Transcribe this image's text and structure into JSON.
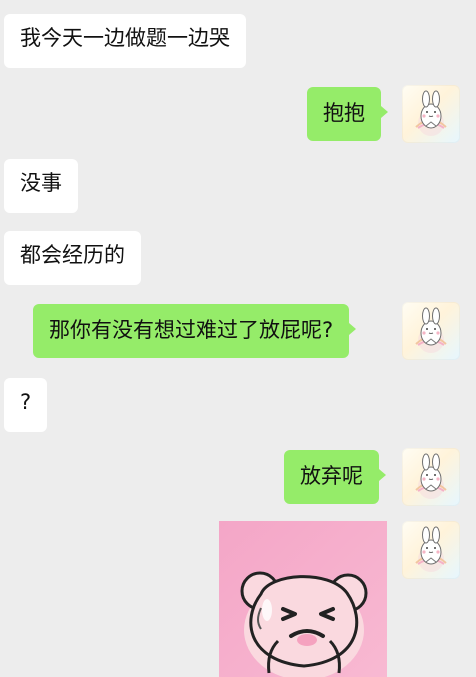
{
  "chat": {
    "messages": [
      {
        "side": "incoming",
        "text": "我今天一边做题一边哭"
      },
      {
        "side": "outgoing",
        "text": "抱抱"
      },
      {
        "side": "incoming",
        "text": "没事"
      },
      {
        "side": "incoming",
        "text": "都会经历的"
      },
      {
        "side": "outgoing",
        "text": "那你有没有想过难过了放屁呢?"
      },
      {
        "side": "incoming",
        "text": "?"
      },
      {
        "side": "outgoing",
        "text": "放弃呢"
      },
      {
        "side": "outgoing",
        "type": "sticker",
        "description_icon": "pink-bear-sticker"
      }
    ]
  },
  "theme": {
    "background": "#ededed",
    "incoming_bubble": "#ffffff",
    "outgoing_bubble": "#95ec69",
    "sticker_background": "#f6a8c8",
    "avatar_accent": "#f4b9c8"
  },
  "icons": {
    "user_avatar": "bunny-avatar-icon",
    "sticker": "pink-bear-sticker"
  }
}
